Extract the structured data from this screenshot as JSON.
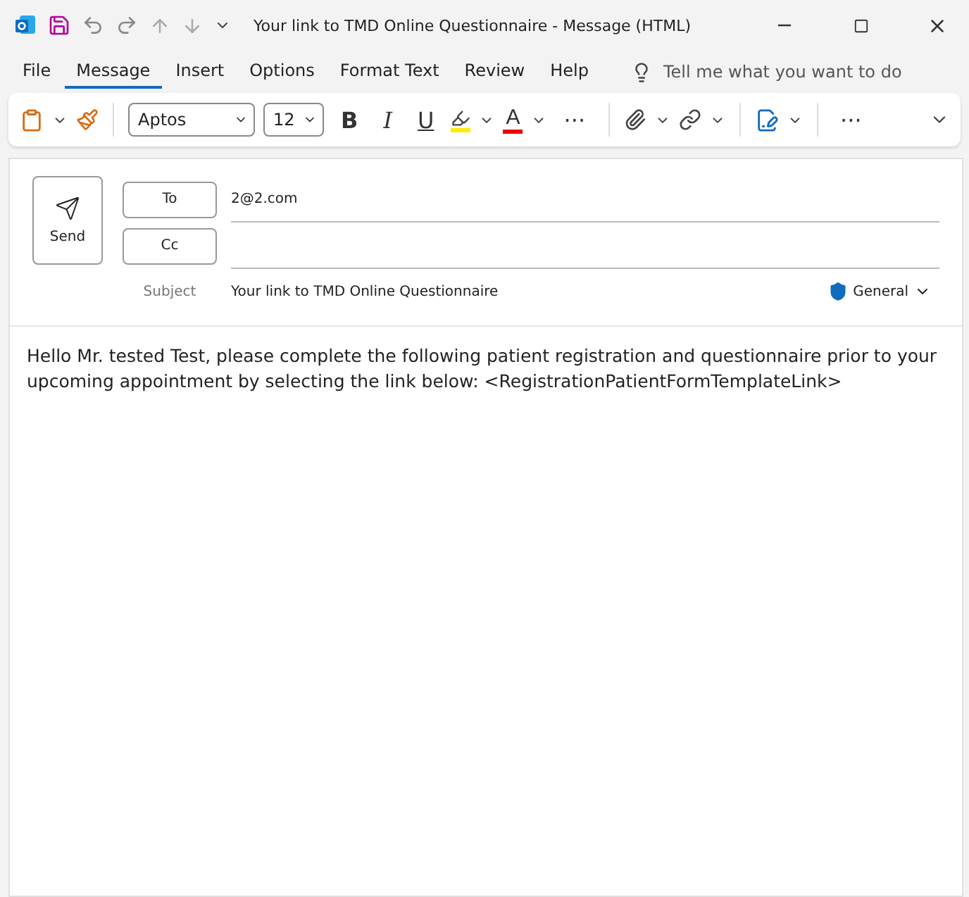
{
  "window": {
    "title": "Your link to TMD Online Questionnaire  -  Message (HTML)"
  },
  "ribbon_tabs": [
    {
      "label": "File",
      "selected": false
    },
    {
      "label": "Message",
      "selected": true
    },
    {
      "label": "Insert",
      "selected": false
    },
    {
      "label": "Options",
      "selected": false
    },
    {
      "label": "Format Text",
      "selected": false
    },
    {
      "label": "Review",
      "selected": false
    },
    {
      "label": "Help",
      "selected": false
    }
  ],
  "search": {
    "placeholder": "Tell me what you want to do"
  },
  "toolbar": {
    "font": "Aptos",
    "size": "12",
    "bold": "B",
    "italic": "I",
    "underline": "U",
    "font_color": "A",
    "more": "···",
    "overflow": "···"
  },
  "compose": {
    "send": "Send",
    "to_label": "To",
    "to_value": "2@2.com",
    "cc_label": "Cc",
    "subject_label": "Subject",
    "subject_value": "Your link to TMD Online Questionnaire",
    "sensitivity": "General"
  },
  "body": "Hello Mr. tested Test, please complete the following patient registration and questionnaire prior to your upcoming appointment by selecting the link below: <RegistrationPatientFormTemplateLink>"
}
